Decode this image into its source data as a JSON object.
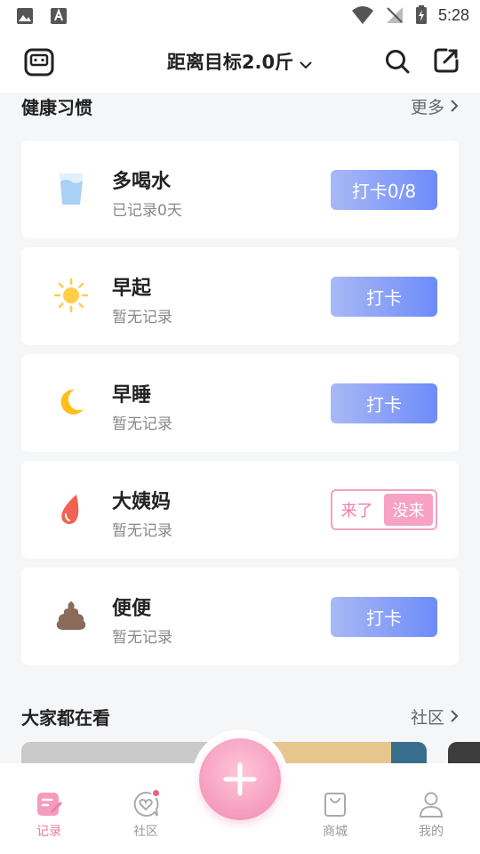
{
  "status_bar": {
    "time": "5:28"
  },
  "header": {
    "title": "距离目标2.0斤"
  },
  "habits_section": {
    "title": "健康习惯",
    "more_label": "更多"
  },
  "habits": [
    {
      "icon": "water-cup-icon",
      "name": "多喝水",
      "status": "已记录0天",
      "button": "打卡0/8"
    },
    {
      "icon": "sun-icon",
      "name": "早起",
      "status": "暂无记录",
      "button": "打卡"
    },
    {
      "icon": "moon-icon",
      "name": "早睡",
      "status": "暂无记录",
      "button": "打卡"
    },
    {
      "icon": "blood-drop-icon",
      "name": "大姨妈",
      "status": "暂无记录",
      "options": [
        "来了",
        "没来"
      ],
      "selected": "没来"
    },
    {
      "icon": "poop-icon",
      "name": "便便",
      "status": "暂无记录",
      "button": "打卡"
    }
  ],
  "community_section": {
    "title": "大家都在看",
    "more_label": "社区"
  },
  "tabbar": {
    "tabs": [
      {
        "label": "记录",
        "icon": "note-icon",
        "active": true
      },
      {
        "label": "社区",
        "icon": "heart-chat-icon",
        "badge": true
      },
      {
        "label": "商城",
        "icon": "shopping-bag-icon"
      },
      {
        "label": "我的",
        "icon": "person-icon"
      }
    ],
    "fab_icon": "plus-icon"
  },
  "colors": {
    "accent_pink": "#f27aa8",
    "button_blue": "#6d8cfa",
    "background": "#f5f6f8"
  }
}
